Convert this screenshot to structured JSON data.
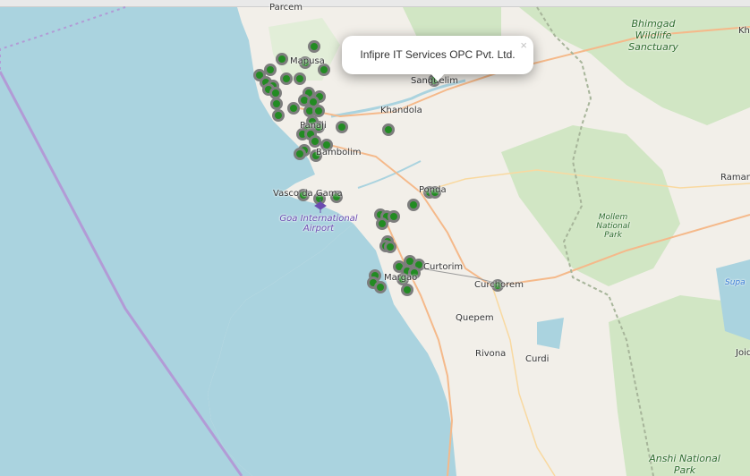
{
  "map": {
    "labels": {
      "parcem": "Parcem",
      "mapusa": "Mapusa",
      "panaji": "Panaji",
      "bambolim": "Bambolim",
      "vasco": "Vasco da Gama",
      "airport": "Goa International Airport",
      "khandola": "Khandola",
      "sanquelim": "Sanquelim",
      "ponda": "Ponda",
      "margao": "Margao",
      "curtorim": "Curtorim",
      "curchorem": "Curchorem",
      "quepem": "Quepem",
      "rivona": "Rivona",
      "curdi": "Curdi",
      "bhimgad": "Bhimgad Wildlife Sanctuary",
      "mollem": "Mollem National Park",
      "ramnagar": "Raman",
      "supa": "Supa",
      "joida": "Joid",
      "anshi": "Anshi National Park",
      "kh": "Kh"
    },
    "colors": {
      "sea": "#aad3df",
      "land": "#f2efe9",
      "park": "#d1e6c4",
      "marker_fill": "#228b22",
      "marker_stroke": "#7d7d7d",
      "road": "#f5b98a",
      "boundary": "#b29bd6"
    }
  },
  "popup": {
    "title": "Infipre IT Services OPC Pvt. Ltd.",
    "close_label": "×"
  }
}
